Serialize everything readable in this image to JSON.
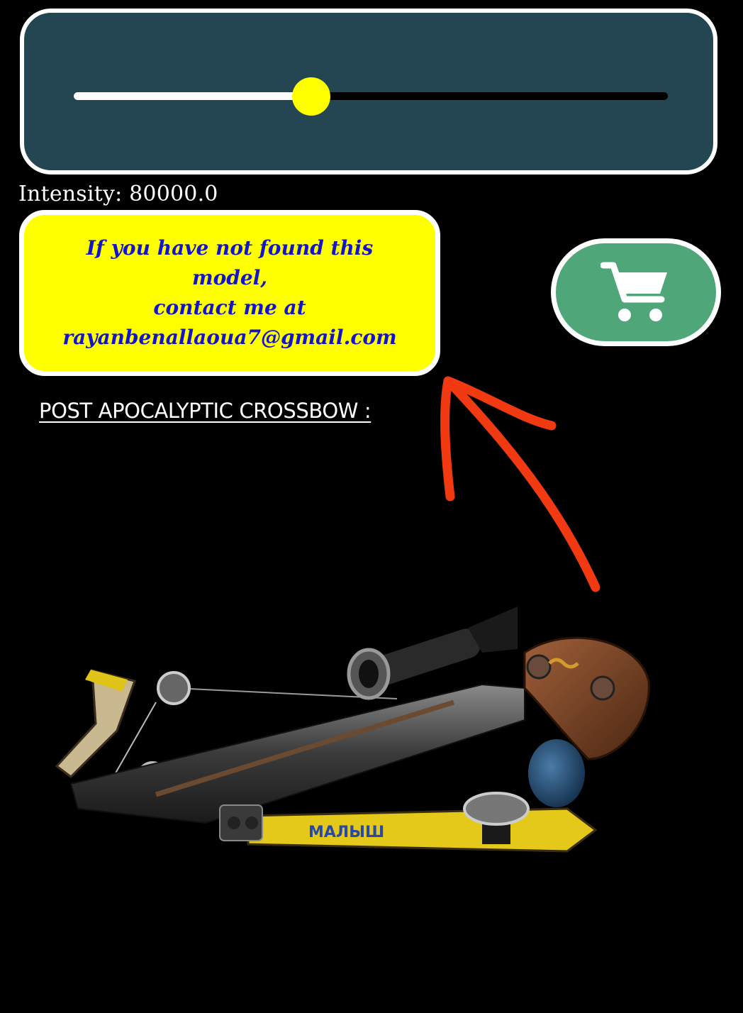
{
  "slider": {
    "value": 80000.0,
    "fraction": 0.4,
    "track_color": "#000000",
    "fill_color": "#ffffff",
    "thumb_color": "#ffff00",
    "panel_color": "#244552"
  },
  "intensity": {
    "label": "Intensity: 80000.0"
  },
  "info": {
    "text": "If you have not found this model,\ncontact me at\nrayanbenallaoua7@gmail.com",
    "bg_color": "#ffff00",
    "text_color": "#1515c8"
  },
  "cart": {
    "icon": "shopping-cart-icon",
    "bg_color": "#4ea679"
  },
  "model": {
    "title": "POST APOCALYPTIC CROSSBOW :",
    "stock_text": "МАЛЫШ"
  },
  "annotation": {
    "arrow_color": "#f23a12"
  }
}
